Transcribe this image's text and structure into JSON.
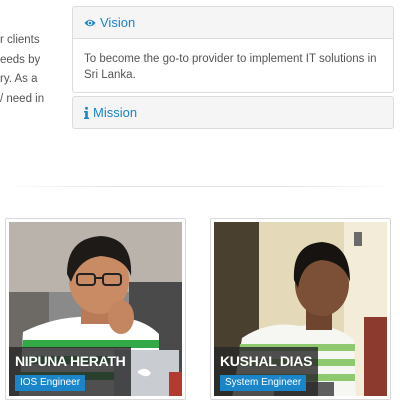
{
  "intro": {
    "lines": [
      "r clients",
      "eeds by",
      "ry. As a",
      "/ need in"
    ]
  },
  "vision": {
    "title": "Vision",
    "icon": "eye-icon",
    "body": "To become the go-to provider to implement IT solutions in Sri Lanka."
  },
  "mission": {
    "title": "Mission",
    "icon": "info-icon"
  },
  "team": [
    {
      "name": "NIPUNA HERATH",
      "role": "IOS Engineer"
    },
    {
      "name": "KUSHAL DIAS",
      "role": "System Engineer"
    }
  ],
  "colors": {
    "accent": "#1a85c8",
    "panel_bg": "#f5f5f5",
    "text": "#555555"
  }
}
